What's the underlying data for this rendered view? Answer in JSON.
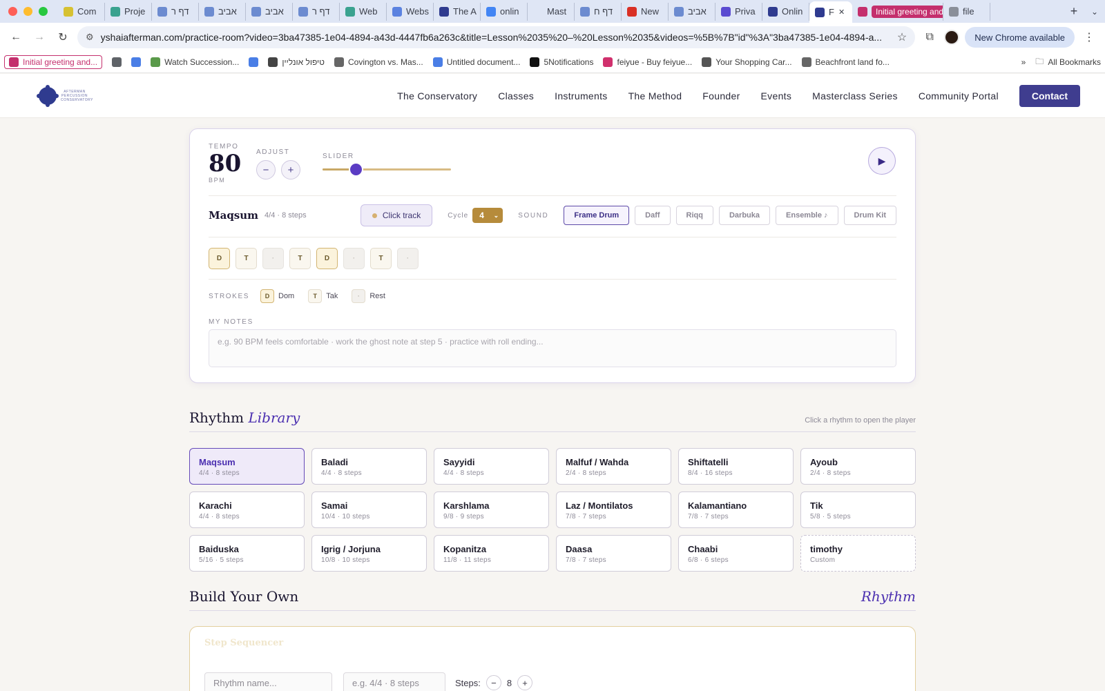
{
  "browser": {
    "tabs": [
      {
        "label": "Com",
        "icon": "#d6c132"
      },
      {
        "label": "Proje",
        "icon": "#3aa28f"
      },
      {
        "label": "דף ר",
        "icon": "#6c8bd0"
      },
      {
        "label": "אביב",
        "icon": "#6c8bd0"
      },
      {
        "label": "אביב",
        "icon": "#6c8bd0"
      },
      {
        "label": "דף ר",
        "icon": "#6c8bd0"
      },
      {
        "label": "Web",
        "icon": "#3aa28f"
      },
      {
        "label": "Webs",
        "icon": "#5b82e0"
      },
      {
        "label": "The A",
        "icon": "#2f3b8f"
      },
      {
        "label": "onlin",
        "icon": "#4285f4"
      },
      {
        "label": "Mast",
        "icon": "#dfe6f5"
      },
      {
        "label": "דף ח",
        "icon": "#6c8bd0"
      },
      {
        "label": "New",
        "icon": "#d93025"
      },
      {
        "label": "אביב",
        "icon": "#6c8bd0"
      },
      {
        "label": "Priva",
        "icon": "#5a4bd1"
      },
      {
        "label": "Onlin",
        "icon": "#2f3b8f"
      },
      {
        "label": "F",
        "icon": "#2f3b8f",
        "active": true
      },
      {
        "label": "Initial greeting and",
        "icon": "#c42f6d",
        "pink": true
      },
      {
        "label": "file",
        "icon": "#8a8f99"
      }
    ],
    "new_tab": "+",
    "url": "yshaiafterman.com/practice-room?video=3ba47385-1e04-4894-a43d-4447fb6a263c&title=Lesson%2035%20–%20Lesson%2035&videos=%5B%7B\"id\"%3A\"3ba47385-1e04-4894-a...",
    "chrome_available": "New Chrome available",
    "bookmarks": [
      {
        "label": "Initial greeting and...",
        "icon": "#c42f6d"
      },
      {
        "label": "",
        "icon": "#5f6368"
      },
      {
        "label": "",
        "icon": "#4a7ee6"
      },
      {
        "label": "Watch Succession...",
        "icon": "#5a9a4a"
      },
      {
        "label": "",
        "icon": "#4a7ee6"
      },
      {
        "label": "טיפול אונליין",
        "icon": "#444"
      },
      {
        "label": "Covington vs. Mas...",
        "icon": "#666"
      },
      {
        "label": "Untitled document...",
        "icon": "#4a7ee6"
      },
      {
        "label": "5Notifications",
        "icon": "#111"
      },
      {
        "label": "feiyue - Buy feiyue...",
        "icon": "#d0306d"
      },
      {
        "label": "Your Shopping Car...",
        "icon": "#555"
      },
      {
        "label": "Beachfront land fo...",
        "icon": "#666"
      }
    ],
    "all_bookmarks": "All Bookmarks"
  },
  "site": {
    "logo_text": "AFTERMAN PERCUSSION CONSERVATORY",
    "nav": [
      "The Conservatory",
      "Classes",
      "Instruments",
      "The Method",
      "Founder",
      "Events",
      "Masterclass Series",
      "Community Portal"
    ],
    "contact": "Contact"
  },
  "player": {
    "tempo_label": "TEMPO",
    "tempo_value": "80",
    "bpm_label": "BPM",
    "adjust_label": "ADJUST",
    "minus": "−",
    "plus": "+",
    "slider_label": "SLIDER",
    "slider_fraction": 0.26,
    "rhythm_name": "Maqsum",
    "rhythm_meta": "4/4 · 8 steps",
    "click_track": "Click track",
    "cycle_label": "Cycle",
    "cycle_value": "4",
    "sound_label": "SOUND",
    "sounds": [
      {
        "label": "Frame Drum",
        "selected": true
      },
      {
        "label": "Daff",
        "selected": false
      },
      {
        "label": "Riqq",
        "selected": false
      },
      {
        "label": "Darbuka",
        "selected": false
      },
      {
        "label": "Ensemble ♪",
        "selected": false
      },
      {
        "label": "Drum Kit",
        "selected": false
      }
    ],
    "steps": [
      "D",
      "T",
      "·",
      "T",
      "D",
      "·",
      "T",
      "·"
    ],
    "strokes_label": "STROKES",
    "legend": [
      {
        "chip": "D",
        "label": "Dom",
        "kind": "dom"
      },
      {
        "chip": "T",
        "label": "Tak",
        "kind": "tak"
      },
      {
        "chip": "·",
        "label": "Rest",
        "kind": "rest"
      }
    ],
    "notes_label": "MY NOTES",
    "notes_placeholder": "e.g. 90 BPM feels comfortable · work the ghost note at step 5 · practice with roll ending..."
  },
  "library": {
    "title": "Rhythm",
    "title_italic": "Library",
    "hint": "Click a rhythm to open the player",
    "items": [
      {
        "name": "Maqsum",
        "meta": "4/4 · 8 steps",
        "selected": true
      },
      {
        "name": "Baladi",
        "meta": "4/4 · 8 steps"
      },
      {
        "name": "Sayyidi",
        "meta": "4/4 · 8 steps"
      },
      {
        "name": "Malfuf / Wahda",
        "meta": "2/4 · 8 steps"
      },
      {
        "name": "Shiftatelli",
        "meta": "8/4 · 16 steps"
      },
      {
        "name": "Ayoub",
        "meta": "2/4 · 8 steps"
      },
      {
        "name": "Karachi",
        "meta": "4/4 · 8 steps"
      },
      {
        "name": "Samai",
        "meta": "10/4 · 10 steps"
      },
      {
        "name": "Karshlama",
        "meta": "9/8 · 9 steps"
      },
      {
        "name": "Laz / Montilatos",
        "meta": "7/8 · 7 steps"
      },
      {
        "name": "Kalamantiano",
        "meta": "7/8 · 7 steps"
      },
      {
        "name": "Tik",
        "meta": "5/8 · 5 steps"
      },
      {
        "name": "Baiduska",
        "meta": "5/16 · 5 steps"
      },
      {
        "name": "Igrig / Jorjuna",
        "meta": "10/8 · 10 steps"
      },
      {
        "name": "Kopanitza",
        "meta": "11/8 · 11 steps"
      },
      {
        "name": "Daasa",
        "meta": "7/8 · 7 steps"
      },
      {
        "name": "Chaabi",
        "meta": "6/8 · 6 steps"
      },
      {
        "name": "timothy",
        "meta": "Custom",
        "custom": true
      }
    ]
  },
  "builder": {
    "title": "Build Your Own",
    "title_right": "Rhythm",
    "seq_title": "Step Sequencer",
    "name_placeholder": "Rhythm name...",
    "meter_placeholder": "e.g. 4/4 · 8 steps",
    "steps_label": "Steps:",
    "steps_value": "8",
    "minus": "−",
    "plus": "+"
  }
}
